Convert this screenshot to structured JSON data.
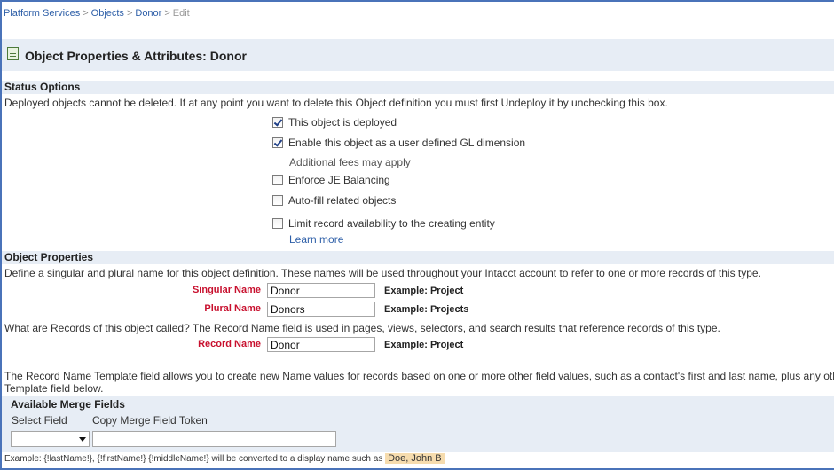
{
  "breadcrumb": {
    "items": [
      "Platform Services",
      "Objects",
      "Donor"
    ],
    "current": "Edit",
    "separator": ">"
  },
  "header": {
    "title": "Object Properties & Attributes: Donor"
  },
  "status_options": {
    "heading": "Status Options",
    "description": "Deployed objects cannot be deleted. If at any point you want to delete this Object definition you must first Undeploy it by unchecking this box.",
    "checkboxes": [
      {
        "label": "This object is deployed",
        "checked": true
      },
      {
        "label": "Enable this object as a user defined GL dimension",
        "checked": true
      },
      {
        "label": "Enforce JE Balancing",
        "checked": false
      },
      {
        "label": "Auto-fill related objects",
        "checked": false
      },
      {
        "label": "Limit record availability to the creating entity",
        "checked": false
      }
    ],
    "fees_note": "Additional fees may apply",
    "learn_more": "Learn more"
  },
  "object_properties": {
    "heading": "Object Properties",
    "description": "Define a singular and plural name for this object definition. These names will be used throughout your Intacct account to refer to one or more records of this type.",
    "singular": {
      "label": "Singular Name",
      "value": "Donor",
      "example": "Example: Project"
    },
    "plural": {
      "label": "Plural Name",
      "value": "Donors",
      "example": "Example: Projects"
    },
    "record_question": "What are Records of this object called? The Record Name field is used in pages, views, selectors, and search results that reference records of this type.",
    "record": {
      "label": "Record Name",
      "value": "Donor",
      "example": "Example: Project"
    },
    "template_text_1": "The Record Name Template field allows you to create new Name values for records based on one or more other field values, such as a contact's first and last name, plus any oth",
    "template_text_2": "Template field below."
  },
  "merge": {
    "title": "Available Merge Fields",
    "select_label": "Select Field",
    "token_label": "Copy Merge Field Token",
    "select_value": "",
    "token_value": ""
  },
  "example_line": {
    "text": "Example: {!lastName!}, {!firstName!} {!middleName!} will be converted to a display name such as",
    "highlight": "Doe, John B"
  }
}
